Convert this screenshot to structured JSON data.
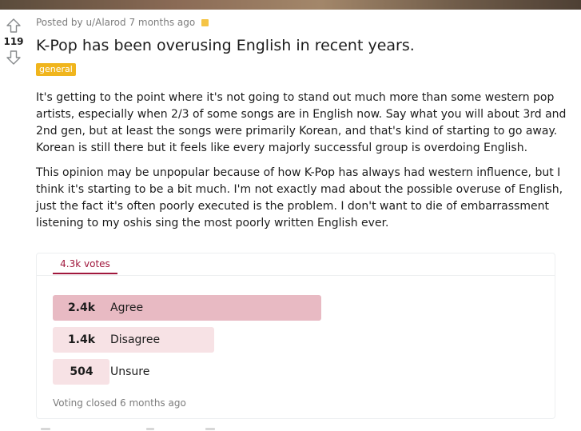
{
  "post": {
    "score": "119",
    "meta_text": "Posted by u/Alarod 7 months ago",
    "title": "K-Pop has been overusing English in recent years.",
    "flair": "general",
    "paragraphs": [
      "It's getting to the point where it's not going to stand out much more than some western pop artists, especially when 2/3 of some songs are in English now. Say what you will about 3rd and 2nd gen, but at least the songs were primarily Korean, and that's kind of starting to go away. Korean is still there but it feels like every majorly successful group is overdoing English.",
      "This opinion may be unpopular because of how K-Pop has always had western influence, but I think it's starting to be a bit much. I'm not exactly mad about the possible overuse of English, just the fact it's often poorly executed is the problem. I don't want to die of embarrassment listening to my oshis sing the most poorly written English ever."
    ]
  },
  "poll": {
    "tab_label": "4.3k votes",
    "options": [
      {
        "count": "2.4k",
        "label": "Agree",
        "fraction": 0.56,
        "color": "#e8bac3"
      },
      {
        "count": "1.4k",
        "label": "Disagree",
        "fraction": 0.337,
        "color": "#f7e2e5"
      },
      {
        "count": "504",
        "label": "Unsure",
        "fraction": 0.118,
        "color": "#f7e2e5"
      }
    ],
    "footer": "Voting closed 6 months ago"
  },
  "icons": {
    "upvote": "upvote-arrow-icon",
    "downvote": "downvote-arrow-icon",
    "award": "award-icon"
  },
  "colors": {
    "accent": "#a0173c",
    "flair_bg": "#f0b51d"
  }
}
